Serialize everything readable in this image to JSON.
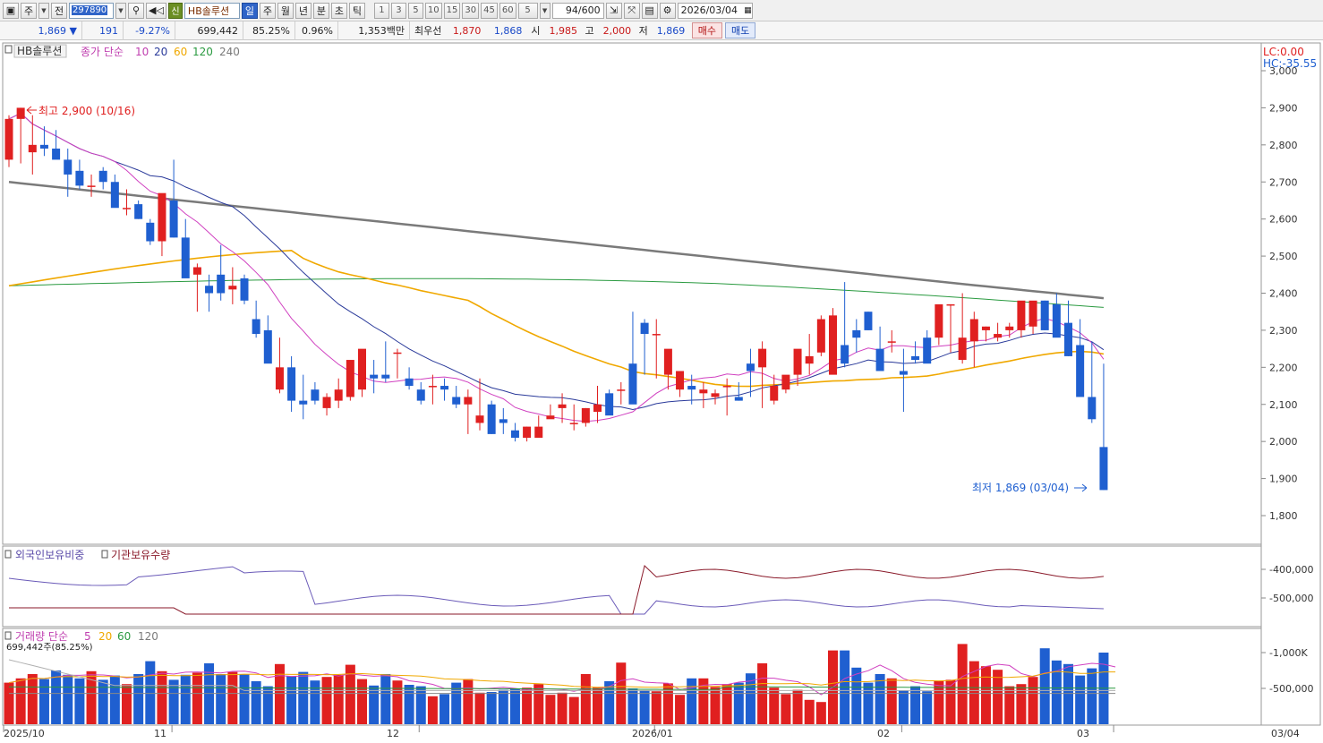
{
  "toolbar": {
    "type_label": "주",
    "all_label": "전",
    "code": "297890",
    "sin_badge": "신",
    "name": "HB솔루션",
    "periods": [
      "일",
      "주",
      "월",
      "년",
      "분",
      "초",
      "틱"
    ],
    "active_period": "일",
    "numbers": [
      "1",
      "3",
      "5",
      "10",
      "15",
      "30",
      "45",
      "60"
    ],
    "tick_value": "5",
    "count": "94/600",
    "date": "2026/03/04"
  },
  "quote": {
    "price": "1,869",
    "change": "191",
    "change_pct": "-9.27%",
    "volume": "699,442",
    "vol_ratio": "85.25%",
    "turnover_pct": "0.96%",
    "amount": "1,353백만",
    "best_label": "최우선",
    "ask": "1,870",
    "bid": "1,868",
    "open_label": "시",
    "open": "1,985",
    "high_label": "고",
    "high": "2,000",
    "low_label": "저",
    "low": "1,869",
    "buy_label": "매수",
    "sell_label": "매도"
  },
  "price_panel": {
    "legend_name": "HB솔루션",
    "legend_ma_label": "종가 단순",
    "ma_periods": [
      "10",
      "20",
      "60",
      "120",
      "240"
    ],
    "lc_label": "LC:0.00",
    "hc_label": "HC:-35.55",
    "high_marker": "최고 2,900 (10/16)",
    "low_marker": "최저 1,869 (03/04)",
    "y_ticks": [
      "3,000",
      "2,900",
      "2,800",
      "2,700",
      "2,600",
      "2,500",
      "2,400",
      "2,300",
      "2,200",
      "2,100",
      "2,000",
      "1,900",
      "1,800"
    ]
  },
  "holding_panel": {
    "foreign_label": "외국인보유비중",
    "inst_label": "기관보유수량",
    "y_ticks": [
      "400,000",
      "500,000"
    ]
  },
  "volume_panel": {
    "legend_label": "거래량 단순",
    "ma_periods": [
      "5",
      "20",
      "60",
      "120"
    ],
    "current": "699,442주(85.25%)",
    "y_ticks": [
      "1,000K",
      "500,000"
    ]
  },
  "x_axis": {
    "labels": [
      "2025/10",
      "11",
      "12",
      "2026/01",
      "02",
      "03"
    ],
    "last_label": "03/04"
  },
  "colors": {
    "up": "#e02020",
    "down": "#1f5fd0",
    "ma10": "#d040c0",
    "ma20": "#2a3a9a",
    "ma60": "#f0a800",
    "ma120": "#2a9a40",
    "ma240": "#7a7a7a"
  },
  "chart_data": {
    "type": "candlestick",
    "dates": [
      "2025-10-14",
      "2025-10-15",
      "2025-10-16",
      "2025-10-17",
      "2025-10-20",
      "2025-10-21",
      "2025-10-22",
      "2025-10-23",
      "2025-10-24",
      "2025-10-27",
      "2025-10-28",
      "2025-10-29",
      "2025-10-30",
      "2025-10-31",
      "2025-11-03",
      "2025-11-04",
      "2025-11-05",
      "2025-11-06",
      "2025-11-07",
      "2025-11-10",
      "2025-11-11",
      "2025-11-12",
      "2025-11-13",
      "2025-11-14",
      "2025-11-17",
      "2025-11-18",
      "2025-11-19",
      "2025-11-20",
      "2025-11-21",
      "2025-11-24",
      "2025-11-25",
      "2025-11-26",
      "2025-11-27",
      "2025-11-28",
      "2025-12-01",
      "2025-12-02",
      "2025-12-03",
      "2025-12-04",
      "2025-12-05",
      "2025-12-08",
      "2025-12-09",
      "2025-12-10",
      "2025-12-11",
      "2025-12-12",
      "2025-12-15",
      "2025-12-16",
      "2025-12-17",
      "2025-12-18",
      "2025-12-19",
      "2025-12-22",
      "2025-12-23",
      "2025-12-24",
      "2025-12-26",
      "2025-12-29",
      "2025-12-30",
      "2026-01-02",
      "2026-01-05",
      "2026-01-06",
      "2026-01-07",
      "2026-01-08",
      "2026-01-09",
      "2026-01-12",
      "2026-01-13",
      "2026-01-14",
      "2026-01-15",
      "2026-01-16",
      "2026-01-19",
      "2026-01-20",
      "2026-01-21",
      "2026-01-22",
      "2026-01-23",
      "2026-01-26",
      "2026-01-27",
      "2026-01-28",
      "2026-01-29",
      "2026-01-30",
      "2026-02-02",
      "2026-02-03",
      "2026-02-04",
      "2026-02-05",
      "2026-02-06",
      "2026-02-09",
      "2026-02-10",
      "2026-02-11",
      "2026-02-12",
      "2026-02-13",
      "2026-02-19",
      "2026-02-20",
      "2026-02-23",
      "2026-02-24",
      "2026-02-25",
      "2026-02-26",
      "2026-02-27",
      "2026-03-03",
      "2026-03-04"
    ],
    "open": [
      2760,
      2870,
      2780,
      2800,
      2790,
      2760,
      2730,
      2690,
      2730,
      2700,
      2630,
      2640,
      2590,
      2540,
      2650,
      2550,
      2450,
      2420,
      2450,
      2410,
      2440,
      2330,
      2300,
      2140,
      2200,
      2110,
      2140,
      2090,
      2110,
      2120,
      2140,
      2180,
      2180,
      2240,
      2170,
      2140,
      2150,
      2150,
      2120,
      2100,
      2050,
      2100,
      2060,
      2030,
      2010,
      2010,
      2060,
      2090,
      2050,
      2050,
      2080,
      2130,
      2140,
      2210,
      2320,
      2290,
      2180,
      2140,
      2150,
      2130,
      2120,
      2150,
      2120,
      2210,
      2200,
      2110,
      2140,
      2180,
      2210,
      2240,
      2180,
      2260,
      2300,
      2350,
      2250,
      2270,
      2190,
      2230,
      2280,
      2280,
      2370,
      2220,
      2270,
      2300,
      2280,
      2300,
      2300,
      2310,
      2380,
      2370,
      2320,
      2260,
      2120,
      1985
    ],
    "high": [
      2880,
      2900,
      2880,
      2850,
      2840,
      2790,
      2760,
      2720,
      2740,
      2720,
      2680,
      2650,
      2600,
      2560,
      2760,
      2600,
      2480,
      2450,
      2530,
      2470,
      2450,
      2380,
      2340,
      2280,
      2230,
      2180,
      2160,
      2130,
      2170,
      2160,
      2180,
      2220,
      2270,
      2250,
      2200,
      2160,
      2180,
      2170,
      2150,
      2140,
      2170,
      2110,
      2090,
      2050,
      2040,
      2070,
      2100,
      2130,
      2100,
      2090,
      2150,
      2140,
      2160,
      2350,
      2330,
      2330,
      2200,
      2180,
      2180,
      2160,
      2140,
      2170,
      2160,
      2250,
      2270,
      2180,
      2160,
      2210,
      2290,
      2340,
      2360,
      2430,
      2330,
      2350,
      2310,
      2300,
      2250,
      2270,
      2300,
      2310,
      2370,
      2400,
      2350,
      2310,
      2320,
      2320,
      2330,
      2330,
      2380,
      2400,
      2380,
      2330,
      2270,
      2210,
      2000
    ],
    "low": [
      2740,
      2750,
      2720,
      2770,
      2770,
      2660,
      2680,
      2660,
      2680,
      2640,
      2610,
      2600,
      2530,
      2500,
      2550,
      2460,
      2350,
      2350,
      2380,
      2370,
      2370,
      2280,
      2230,
      2130,
      2080,
      2060,
      2100,
      2070,
      2090,
      2110,
      2120,
      2130,
      2160,
      2170,
      2140,
      2100,
      2100,
      2110,
      2090,
      2020,
      2030,
      2020,
      2020,
      2000,
      2000,
      2040,
      2070,
      2050,
      2030,
      2040,
      2050,
      2080,
      2100,
      2130,
      2180,
      2170,
      2140,
      2120,
      2100,
      2090,
      2100,
      2070,
      2110,
      2120,
      2090,
      2100,
      2130,
      2150,
      2180,
      2230,
      2260,
      2200,
      2240,
      2300,
      2210,
      2240,
      2080,
      2210,
      2230,
      2260,
      2240,
      2210,
      2200,
      2270,
      2270,
      2280,
      2280,
      2290,
      2300,
      2310,
      2230,
      2180,
      2050,
      1869
    ],
    "close": [
      2870,
      2900,
      2800,
      2790,
      2760,
      2720,
      2690,
      2690,
      2700,
      2630,
      2630,
      2600,
      2540,
      2670,
      2550,
      2440,
      2470,
      2400,
      2400,
      2420,
      2380,
      2290,
      2210,
      2200,
      2110,
      2100,
      2110,
      2120,
      2140,
      2220,
      2250,
      2170,
      2170,
      2240,
      2150,
      2110,
      2150,
      2140,
      2100,
      2120,
      2070,
      2020,
      2050,
      2010,
      2040,
      2040,
      2070,
      2100,
      2050,
      2090,
      2100,
      2070,
      2140,
      2100,
      2290,
      2290,
      2250,
      2190,
      2140,
      2140,
      2130,
      2150,
      2110,
      2190,
      2250,
      2150,
      2180,
      2250,
      2230,
      2330,
      2340,
      2210,
      2280,
      2300,
      2190,
      2270,
      2180,
      2220,
      2210,
      2370,
      2370,
      2280,
      2330,
      2310,
      2290,
      2310,
      2380,
      2380,
      2300,
      2280,
      2230,
      2120,
      2060,
      1869
    ],
    "volume": [
      580,
      640,
      700,
      630,
      750,
      690,
      640,
      740,
      620,
      680,
      560,
      700,
      880,
      740,
      620,
      690,
      720,
      850,
      700,
      730,
      700,
      600,
      530,
      840,
      670,
      730,
      610,
      660,
      690,
      830,
      630,
      540,
      700,
      610,
      550,
      530,
      390,
      420,
      580,
      630,
      440,
      450,
      480,
      500,
      510,
      560,
      410,
      440,
      380,
      700,
      510,
      600,
      860,
      500,
      470,
      460,
      570,
      410,
      640,
      640,
      520,
      560,
      580,
      710,
      850,
      510,
      420,
      480,
      340,
      310,
      1030,
      1030,
      790,
      580,
      700,
      640,
      470,
      530,
      460,
      600,
      620,
      1120,
      880,
      810,
      760,
      530,
      560,
      660,
      1060,
      890,
      840,
      680,
      780,
      1000,
      699
    ]
  }
}
